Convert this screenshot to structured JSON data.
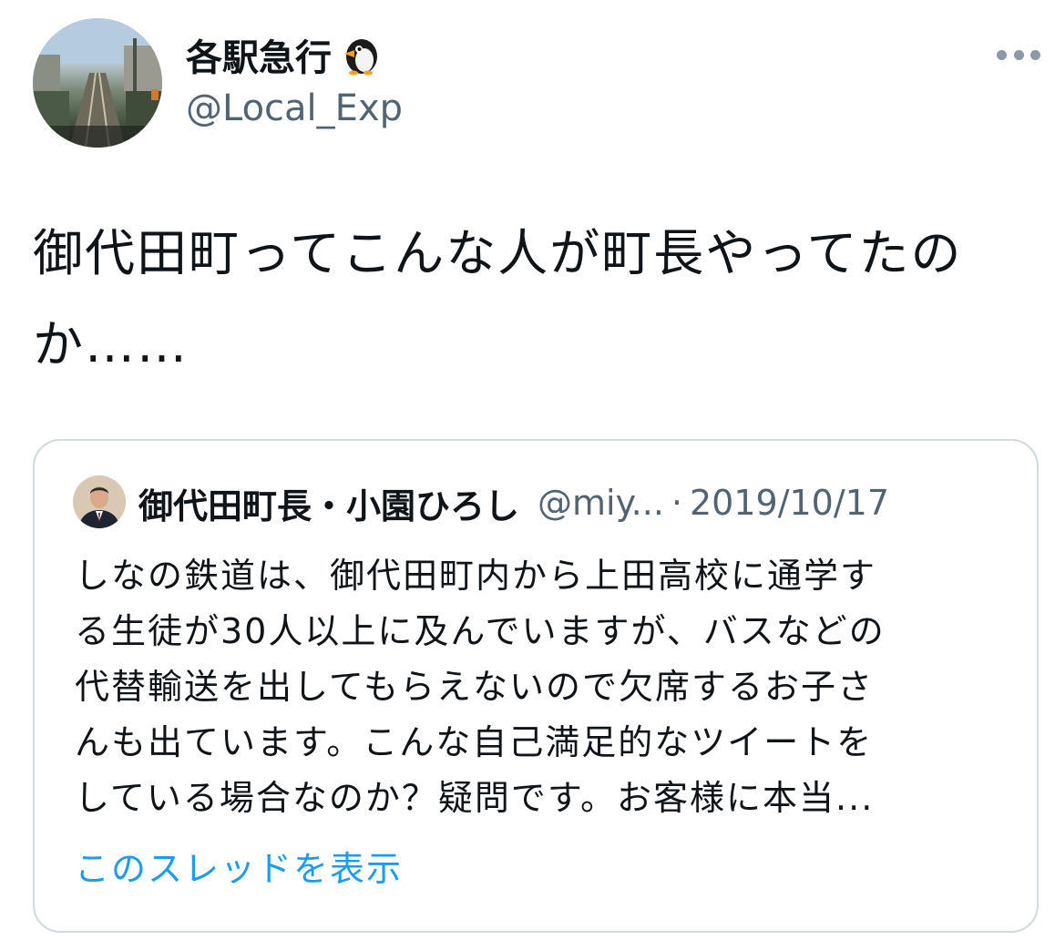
{
  "author": {
    "display_name": "各駅急行",
    "name_emoji_icon": "penguin-icon",
    "handle": "@Local_Exp"
  },
  "tweet": {
    "text": "御代田町ってこんな人が町長やってたのか……"
  },
  "quoted_tweet": {
    "display_name": "御代田町長・小園ひろし",
    "handle": "@miy...",
    "separator": "·",
    "date": "2019/10/17",
    "text_lines": [
      "しなの鉄道は、御代田町内から上田高校に通学す",
      "る生徒が30人以上に及んでいますが、バスなどの",
      "代替輸送を出してもらえないので欠席するお子さ",
      "んも出ています。こんな自己満足的なツイートを",
      "している場合なのか？疑問です。お客様に本当..."
    ],
    "show_thread_label": "このスレッドを表示"
  },
  "colors": {
    "text_primary": "#0f1419",
    "text_secondary": "#536471",
    "link": "#1d9bf0",
    "border": "#cfd9de"
  }
}
